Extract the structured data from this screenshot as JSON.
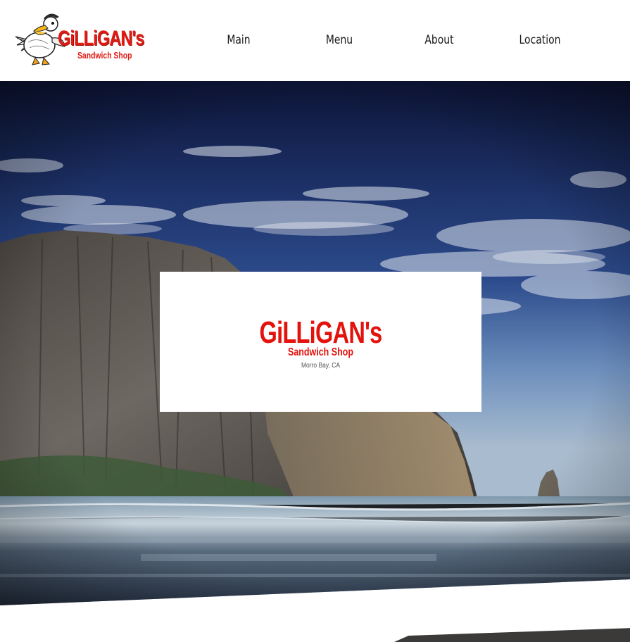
{
  "header": {
    "logo": {
      "name": "GiLLiGAN's",
      "tagline": "Sandwich Shop",
      "icon": "pelican-mascot-icon"
    },
    "nav": [
      {
        "label": "Main"
      },
      {
        "label": "Menu"
      },
      {
        "label": "About"
      },
      {
        "label": "Location"
      }
    ]
  },
  "hero": {
    "image": "morro-rock-beach-photo",
    "card": {
      "name": "GiLLiGAN's",
      "tagline": "Sandwich Shop",
      "location": "Morro Bay, CA"
    }
  },
  "colors": {
    "brand_red": "#e4120d",
    "nav_text": "#1a1a1a",
    "sky_top": "#0d1436",
    "sky_mid": "#2c4b8c"
  }
}
